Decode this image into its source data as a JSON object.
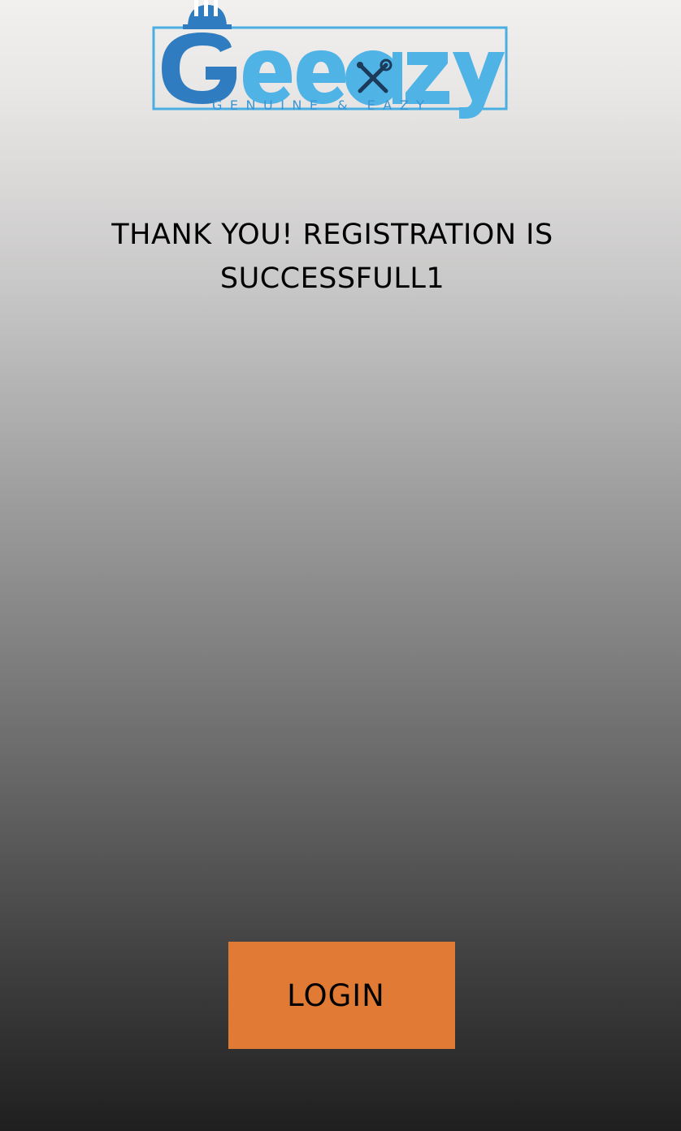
{
  "brand": {
    "name": "Geeazy",
    "tagline": "GENUINE & EAZY",
    "colors": {
      "primary_blue": "#2f7dc0",
      "light_blue": "#4fb3e6",
      "frame_blue": "#4aaee3"
    }
  },
  "message": {
    "text": "THANK YOU! REGISTRATION IS SUCCESSFULL1"
  },
  "actions": {
    "login_label": "LOGIN",
    "login_color": "#e17a34"
  },
  "icons": {
    "logo_mark": "hard-hat-icon",
    "tools": "wrench-screwdriver-icon"
  }
}
